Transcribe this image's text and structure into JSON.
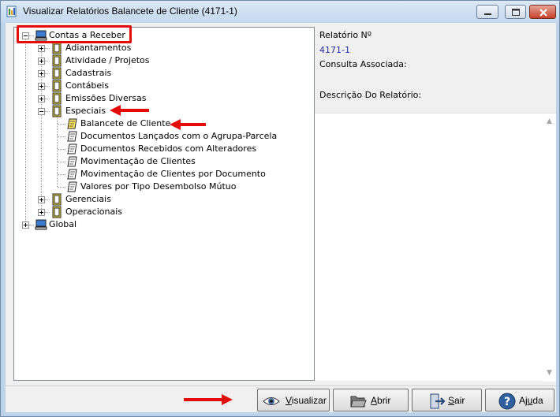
{
  "window": {
    "title": "Visualizar Relatórios Balancete de Cliente (4171-1)",
    "accent": "#bcd3ea"
  },
  "tree": {
    "root": {
      "label": "Contas a Receber",
      "expanded": true,
      "icon": "computer-icon"
    },
    "groups": [
      {
        "label": "Adiantamentos",
        "expanded": false,
        "icon": "folder-icon"
      },
      {
        "label": "Atividade / Projetos",
        "expanded": false,
        "icon": "folder-icon"
      },
      {
        "label": "Cadastrais",
        "expanded": false,
        "icon": "folder-icon"
      },
      {
        "label": "Contábeis",
        "expanded": false,
        "icon": "folder-icon"
      },
      {
        "label": "Emissões Diversas",
        "expanded": false,
        "icon": "folder-icon"
      },
      {
        "label": "Especiais",
        "expanded": true,
        "icon": "folder-icon"
      }
    ],
    "reports": [
      {
        "label": "Balancete de Cliente",
        "selected": true,
        "icon": "report-icon"
      },
      {
        "label": "Documentos Lançados com o Agrupa-Parcela",
        "icon": "report-icon"
      },
      {
        "label": "Documentos Recebidos com Alteradores",
        "icon": "report-icon"
      },
      {
        "label": "Movimentação de Clientes",
        "icon": "report-icon"
      },
      {
        "label": "Movimentação de Clientes por Documento",
        "icon": "report-icon"
      },
      {
        "label": "Valores por Tipo Desembolso Mútuo",
        "icon": "report-icon"
      }
    ],
    "more_groups": [
      {
        "label": "Gerenciais",
        "expanded": false,
        "icon": "folder-icon"
      },
      {
        "label": "Operacionais",
        "expanded": false,
        "icon": "folder-icon"
      }
    ],
    "global": {
      "label": "Global",
      "expanded": false,
      "icon": "computer-icon"
    }
  },
  "info": {
    "relatorio_label": "Relatório Nº",
    "relatorio_value": "4171-1",
    "consulta_label": "Consulta Associada:",
    "descricao_label": "Descrição Do Relatório:"
  },
  "buttons": [
    {
      "key": "visualizar",
      "first": "V",
      "rest": "isualizar",
      "icon": "eye-icon"
    },
    {
      "key": "abrir",
      "first": "A",
      "rest": "brir",
      "icon": "folder-open-icon"
    },
    {
      "key": "sair",
      "first": "S",
      "rest": "air",
      "icon": "exit-icon"
    },
    {
      "key": "ajuda",
      "pre": "Aj",
      "first": "u",
      "rest": "da",
      "icon": "help-icon"
    }
  ],
  "annotation_color": "#e50b0b"
}
